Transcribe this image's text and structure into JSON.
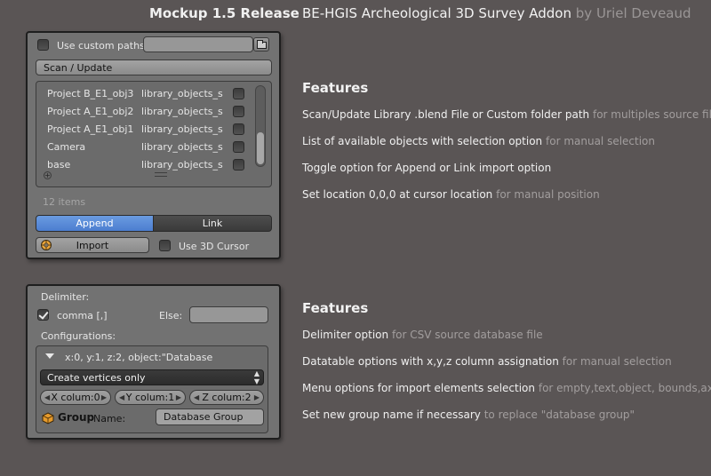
{
  "header": {
    "release": "Mockup 1.5 Release",
    "title": "BE-HGIS Archeological 3D Survey Addon",
    "author": "by Uriel Deveaud"
  },
  "panel1": {
    "use_custom_paths": {
      "label": "Use custom paths",
      "checked": false
    },
    "path_value": "",
    "scan_update_label": "Scan / Update",
    "items": [
      {
        "name": "Project B_E1_obj3",
        "library": "library_objects_s"
      },
      {
        "name": "Project A_E1_obj2",
        "library": "library_objects_s"
      },
      {
        "name": "Project A_E1_obj1",
        "library": "library_objects_s"
      },
      {
        "name": "Camera",
        "library": "library_objects_s"
      },
      {
        "name": "base",
        "library": "library_objects_s"
      }
    ],
    "items_count": "12 items",
    "append_label": "Append",
    "link_label": "Link",
    "import_label": "Import",
    "use_3d_cursor": {
      "label": "Use 3D Cursor",
      "checked": false
    }
  },
  "panel2": {
    "delimiter_label": "Delimiter:",
    "comma": {
      "label": "comma [,]",
      "checked": true
    },
    "else_label": "Else:",
    "else_value": "",
    "configurations_label": "Configurations:",
    "config_header": "x:0, y:1, z:2, object:\"Database",
    "select_value": "Create vertices only",
    "x_col": {
      "label": "X colum:",
      "value": "0"
    },
    "y_col": {
      "label": "Y colum:",
      "value": "1"
    },
    "z_col": {
      "label": "Z colum:",
      "value": "2"
    },
    "group_label": "Group",
    "name_label": "Name:",
    "group_name": "Database Group"
  },
  "features1": {
    "title": "Features",
    "items": [
      {
        "text": "Scan/Update Library .blend File or Custom folder path",
        "hint": "for multiples source files"
      },
      {
        "text": "List of available objects with selection option",
        "hint": "for manual selection"
      },
      {
        "text": "Toggle option for Append or Link import  option",
        "hint": ""
      },
      {
        "text": "Set location 0,0,0 at cursor location",
        "hint": "for manual position"
      }
    ]
  },
  "features2": {
    "title": "Features",
    "items": [
      {
        "text": "Delimiter option",
        "hint": "for CSV source database file"
      },
      {
        "text": "Datatable options with x,y,z column assignation",
        "hint": "for manual selection"
      },
      {
        "text": "Menu options for import elements selection",
        "hint": "for empty,text,object, bounds,axis"
      },
      {
        "text": "Set new group name if necessary",
        "hint": "to replace \"database group\""
      }
    ]
  },
  "colors": {
    "background": "#5a5555",
    "panel": "#727272",
    "accent": "#5b8cd8"
  }
}
